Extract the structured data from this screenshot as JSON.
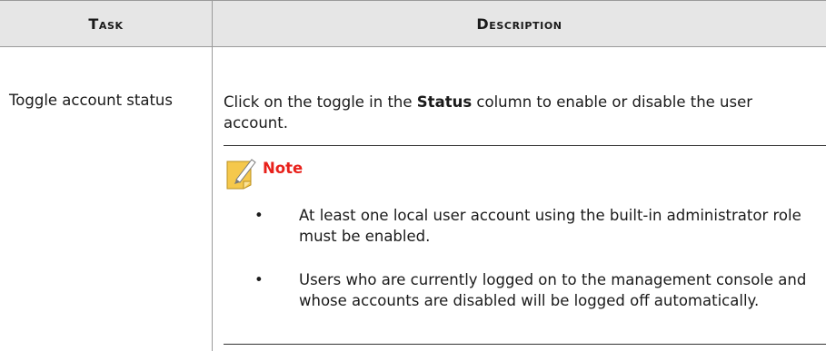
{
  "table": {
    "header": {
      "task": "Task",
      "description": "Description"
    },
    "rows": [
      {
        "task": "Toggle account status",
        "description": {
          "prefix": "Click on the toggle in the ",
          "bold": "Status",
          "suffix": " column to enable or disable the user account."
        },
        "note": {
          "icon": "note-pencil-icon",
          "title": "Note",
          "items": [
            "At least one local user account using the built-in administrator role must be enabled.",
            "Users who are currently logged on to the management console and whose accounts are disabled will be logged off automatically."
          ]
        }
      }
    ]
  },
  "colors": {
    "header_bg": "#e6e6e6",
    "note_title": "#e8211b",
    "note_icon": "#f5c84c"
  }
}
